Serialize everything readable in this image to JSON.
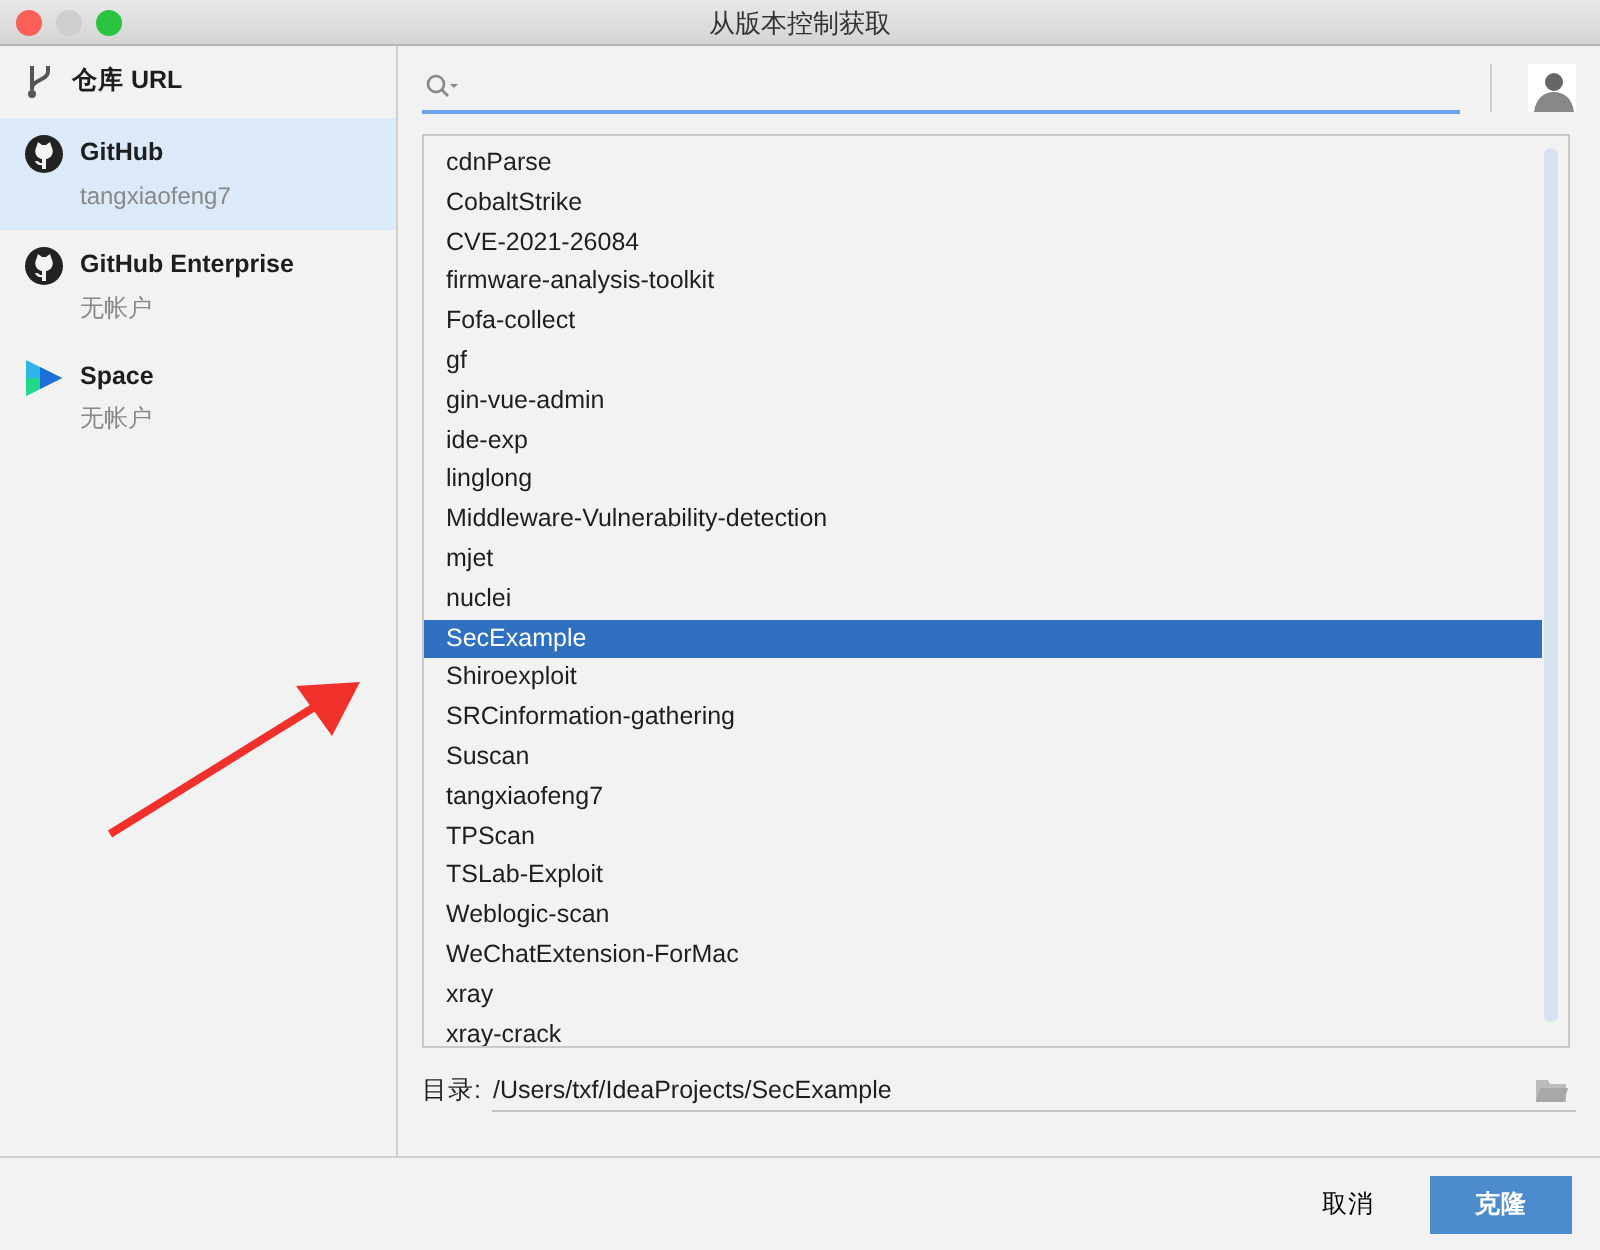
{
  "window": {
    "title": "从版本控制获取"
  },
  "sidebar": {
    "items": [
      {
        "kind": "url",
        "title": "仓库 URL",
        "selected": false
      },
      {
        "kind": "github",
        "title": "GitHub",
        "subtitle": "tangxiaofeng7",
        "selected": true
      },
      {
        "kind": "github",
        "title": "GitHub Enterprise",
        "subtitle": "无帐户",
        "selected": false
      },
      {
        "kind": "space",
        "title": "Space",
        "subtitle": "无帐户",
        "selected": false
      }
    ]
  },
  "repositories": [
    {
      "name": "cdnParse",
      "selected": false
    },
    {
      "name": "CobaltStrike",
      "selected": false
    },
    {
      "name": "CVE-2021-26084",
      "selected": false
    },
    {
      "name": "firmware-analysis-toolkit",
      "selected": false
    },
    {
      "name": "Fofa-collect",
      "selected": false
    },
    {
      "name": "gf",
      "selected": false
    },
    {
      "name": "gin-vue-admin",
      "selected": false
    },
    {
      "name": "ide-exp",
      "selected": false
    },
    {
      "name": "linglong",
      "selected": false
    },
    {
      "name": "Middleware-Vulnerability-detection",
      "selected": false
    },
    {
      "name": "mjet",
      "selected": false
    },
    {
      "name": "nuclei",
      "selected": false
    },
    {
      "name": "SecExample",
      "selected": true
    },
    {
      "name": "Shiroexploit",
      "selected": false
    },
    {
      "name": "SRCinformation-gathering",
      "selected": false
    },
    {
      "name": "Suscan",
      "selected": false
    },
    {
      "name": "tangxiaofeng7",
      "selected": false
    },
    {
      "name": "TPScan",
      "selected": false
    },
    {
      "name": "TSLab-Exploit",
      "selected": false
    },
    {
      "name": "Weblogic-scan",
      "selected": false
    },
    {
      "name": "WeChatExtension-ForMac",
      "selected": false
    },
    {
      "name": "xray",
      "selected": false
    },
    {
      "name": "xray-crack",
      "selected": false
    }
  ],
  "directory": {
    "label": "目录:",
    "value": "/Users/txf/IdeaProjects/SecExample"
  },
  "buttons": [
    {
      "label": "取消",
      "kind": "secondary"
    },
    {
      "label": "克隆",
      "kind": "primary"
    }
  ]
}
